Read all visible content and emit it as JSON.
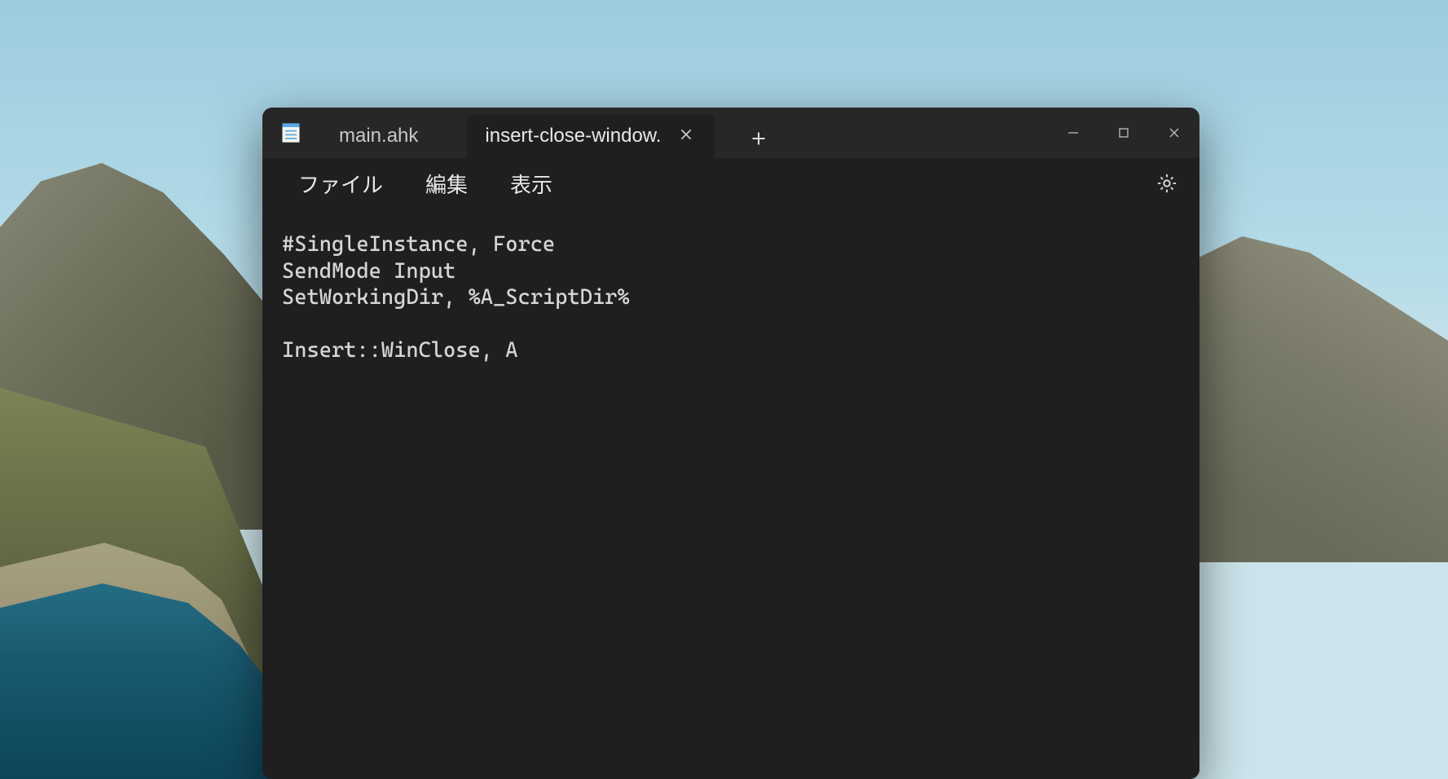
{
  "tabs": [
    {
      "label": "main.ahk",
      "active": false,
      "closeable": true
    },
    {
      "label": "insert-close-window.",
      "active": true,
      "closeable": true
    }
  ],
  "menubar": {
    "file": "ファイル",
    "edit": "編集",
    "view": "表示"
  },
  "editor": {
    "content": "#SingleInstance, Force\nSendMode Input\nSetWorkingDir, %A_ScriptDir%\n\nInsert::WinClose, A"
  },
  "colors": {
    "window_bg": "#272727",
    "content_bg": "#1f1f1f",
    "text": "#d6d6d6"
  }
}
